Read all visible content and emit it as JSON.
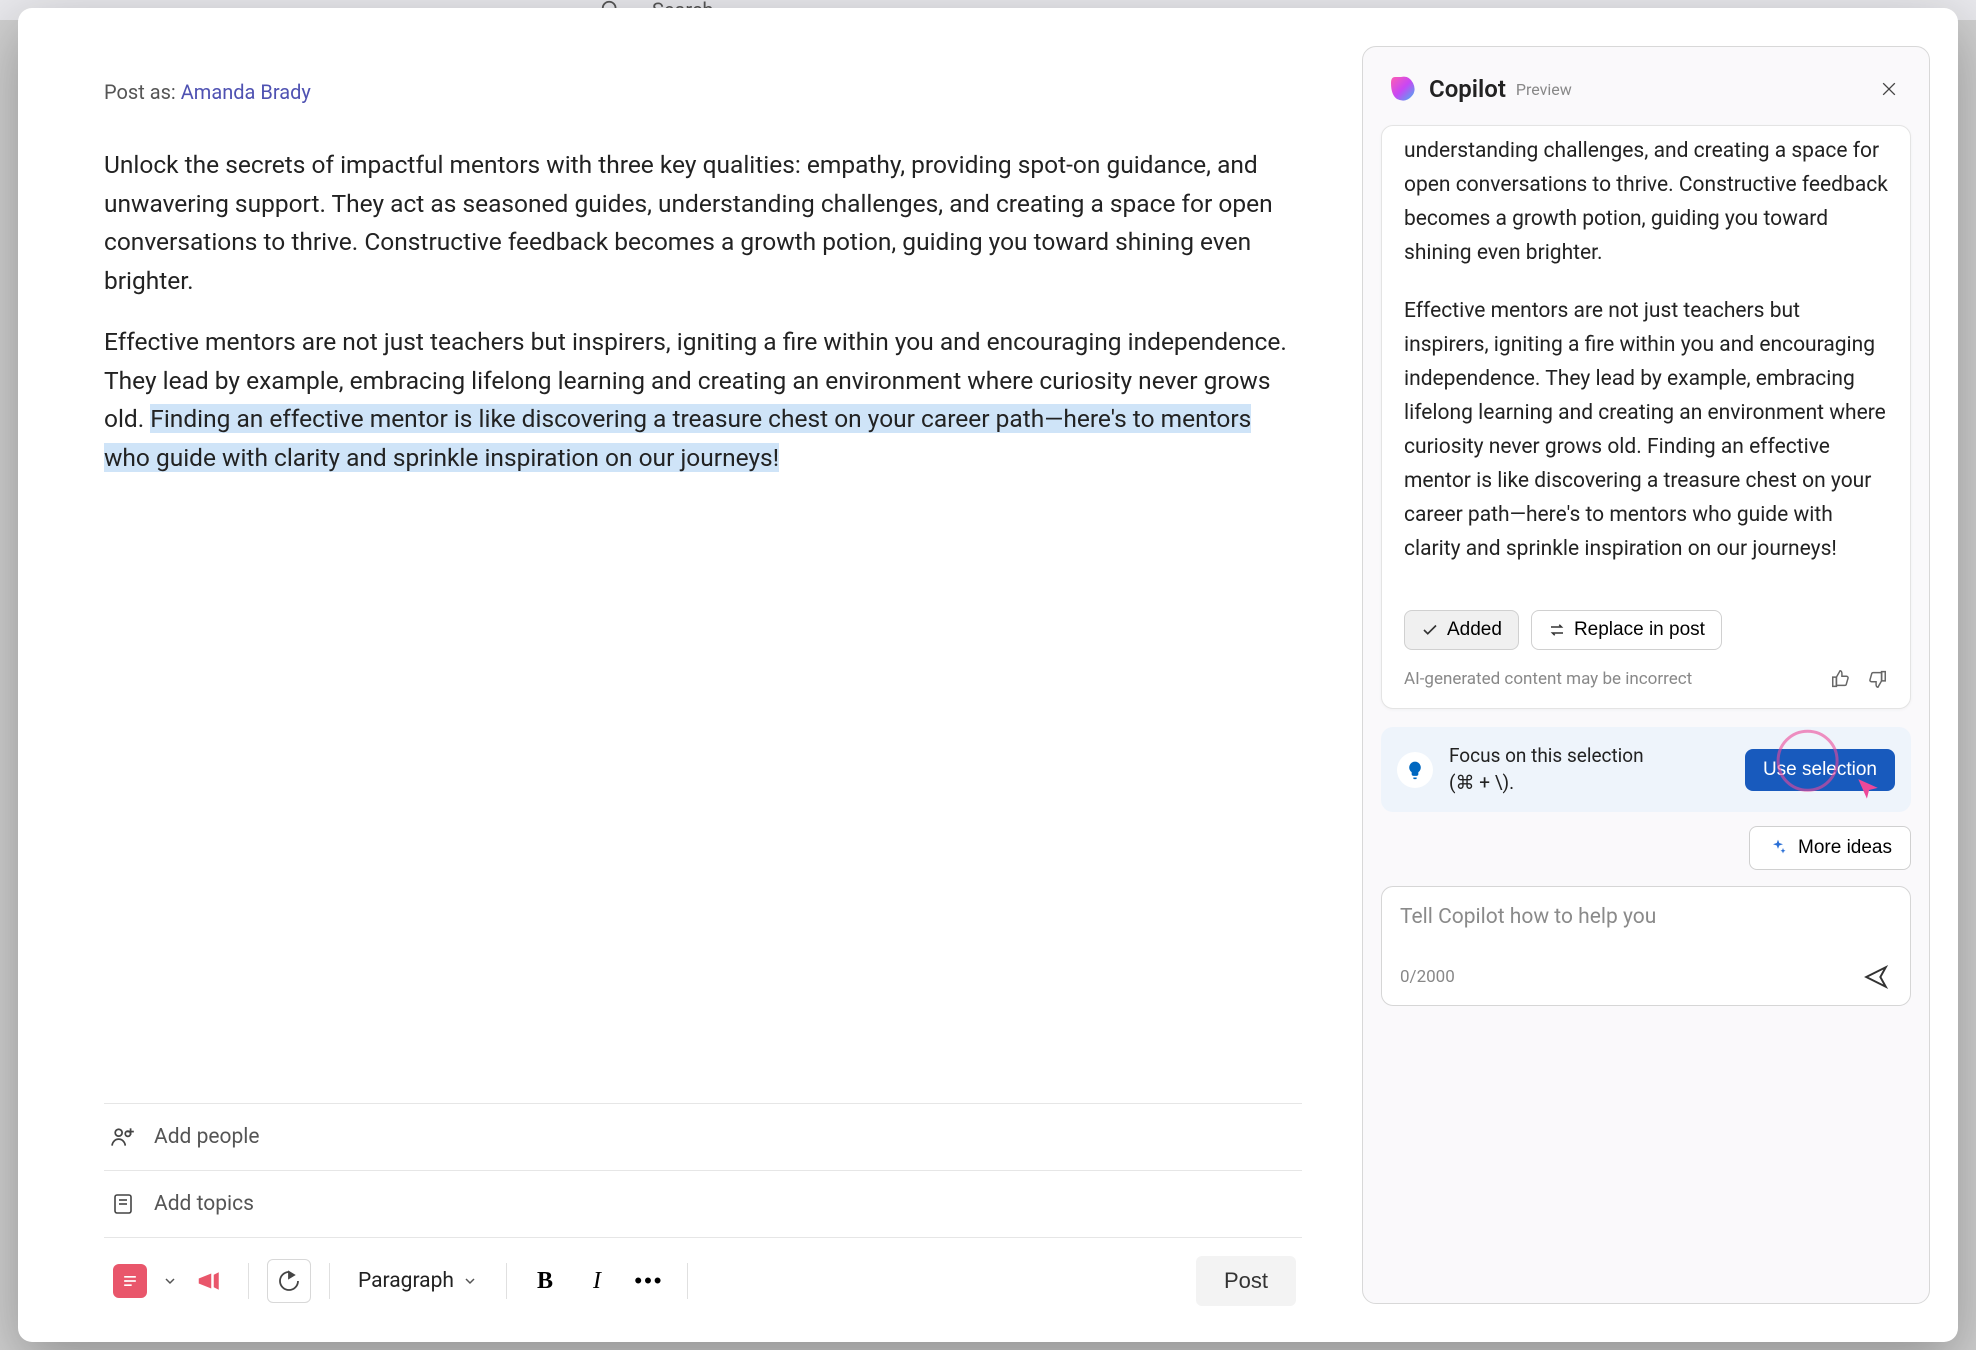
{
  "backdrop": {
    "search": "Search"
  },
  "post_as": {
    "label": "Post as:",
    "name": "Amanda Brady"
  },
  "content": {
    "p1": "Unlock the secrets of impactful mentors with three key qualities: empathy, providing spot-on guidance, and unwavering support. They act as seasoned guides, understanding challenges, and creating a space for open conversations to thrive. Constructive feedback becomes a growth potion, guiding you toward shining even brighter.",
    "p2a": "Effective mentors are not just teachers but inspirers, igniting a fire within you and encouraging independence. They lead by example, embracing lifelong learning and creating an environment where curiosity never grows old. ",
    "p2b_hl": "Finding an effective mentor is like discovering a treasure chest on your career path—here's to mentors who guide with clarity and sprinkle inspiration on our journeys!"
  },
  "rows": {
    "people": "Add people",
    "topics": "Add topics"
  },
  "toolbar": {
    "paragraph": "Paragraph",
    "post": "Post"
  },
  "copilot": {
    "title": "Copilot",
    "preview": "Preview",
    "text_p1": "unwavering support. They act as seasoned guides, understanding challenges, and creating a space for open conversations to thrive. Constructive feedback becomes a growth potion, guiding you toward shining even brighter.",
    "text_p2": "Effective mentors are not just teachers but inspirers, igniting a fire within you and encouraging independence. They lead by example, embracing lifelong learning and creating an environment where curiosity never grows old. Finding an effective mentor is like discovering a treasure chest on your career path—here's to mentors who guide with clarity and sprinkle inspiration on our journeys!",
    "added": "Added",
    "replace": "Replace in post",
    "disclaimer": "AI-generated content may be incorrect",
    "focus_line1": "Focus on this selection",
    "focus_line2": "(⌘ + \\).",
    "use_selection": "Use selection",
    "more_ideas": "More ideas",
    "prompt_placeholder": "Tell Copilot how to help you",
    "char_count": "0/2000"
  }
}
